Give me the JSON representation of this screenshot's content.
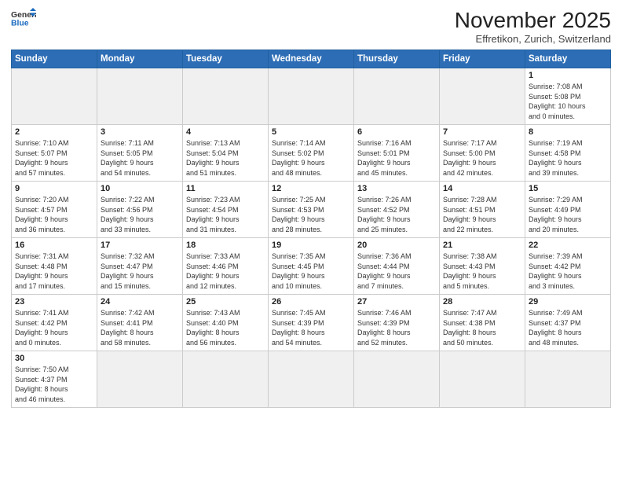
{
  "logo": {
    "line1": "General",
    "line2": "Blue"
  },
  "title": "November 2025",
  "location": "Effretikon, Zurich, Switzerland",
  "weekdays": [
    "Sunday",
    "Monday",
    "Tuesday",
    "Wednesday",
    "Thursday",
    "Friday",
    "Saturday"
  ],
  "weeks": [
    [
      {
        "day": "",
        "info": ""
      },
      {
        "day": "",
        "info": ""
      },
      {
        "day": "",
        "info": ""
      },
      {
        "day": "",
        "info": ""
      },
      {
        "day": "",
        "info": ""
      },
      {
        "day": "",
        "info": ""
      },
      {
        "day": "1",
        "info": "Sunrise: 7:08 AM\nSunset: 5:08 PM\nDaylight: 10 hours\nand 0 minutes."
      }
    ],
    [
      {
        "day": "2",
        "info": "Sunrise: 7:10 AM\nSunset: 5:07 PM\nDaylight: 9 hours\nand 57 minutes."
      },
      {
        "day": "3",
        "info": "Sunrise: 7:11 AM\nSunset: 5:05 PM\nDaylight: 9 hours\nand 54 minutes."
      },
      {
        "day": "4",
        "info": "Sunrise: 7:13 AM\nSunset: 5:04 PM\nDaylight: 9 hours\nand 51 minutes."
      },
      {
        "day": "5",
        "info": "Sunrise: 7:14 AM\nSunset: 5:02 PM\nDaylight: 9 hours\nand 48 minutes."
      },
      {
        "day": "6",
        "info": "Sunrise: 7:16 AM\nSunset: 5:01 PM\nDaylight: 9 hours\nand 45 minutes."
      },
      {
        "day": "7",
        "info": "Sunrise: 7:17 AM\nSunset: 5:00 PM\nDaylight: 9 hours\nand 42 minutes."
      },
      {
        "day": "8",
        "info": "Sunrise: 7:19 AM\nSunset: 4:58 PM\nDaylight: 9 hours\nand 39 minutes."
      }
    ],
    [
      {
        "day": "9",
        "info": "Sunrise: 7:20 AM\nSunset: 4:57 PM\nDaylight: 9 hours\nand 36 minutes."
      },
      {
        "day": "10",
        "info": "Sunrise: 7:22 AM\nSunset: 4:56 PM\nDaylight: 9 hours\nand 33 minutes."
      },
      {
        "day": "11",
        "info": "Sunrise: 7:23 AM\nSunset: 4:54 PM\nDaylight: 9 hours\nand 31 minutes."
      },
      {
        "day": "12",
        "info": "Sunrise: 7:25 AM\nSunset: 4:53 PM\nDaylight: 9 hours\nand 28 minutes."
      },
      {
        "day": "13",
        "info": "Sunrise: 7:26 AM\nSunset: 4:52 PM\nDaylight: 9 hours\nand 25 minutes."
      },
      {
        "day": "14",
        "info": "Sunrise: 7:28 AM\nSunset: 4:51 PM\nDaylight: 9 hours\nand 22 minutes."
      },
      {
        "day": "15",
        "info": "Sunrise: 7:29 AM\nSunset: 4:49 PM\nDaylight: 9 hours\nand 20 minutes."
      }
    ],
    [
      {
        "day": "16",
        "info": "Sunrise: 7:31 AM\nSunset: 4:48 PM\nDaylight: 9 hours\nand 17 minutes."
      },
      {
        "day": "17",
        "info": "Sunrise: 7:32 AM\nSunset: 4:47 PM\nDaylight: 9 hours\nand 15 minutes."
      },
      {
        "day": "18",
        "info": "Sunrise: 7:33 AM\nSunset: 4:46 PM\nDaylight: 9 hours\nand 12 minutes."
      },
      {
        "day": "19",
        "info": "Sunrise: 7:35 AM\nSunset: 4:45 PM\nDaylight: 9 hours\nand 10 minutes."
      },
      {
        "day": "20",
        "info": "Sunrise: 7:36 AM\nSunset: 4:44 PM\nDaylight: 9 hours\nand 7 minutes."
      },
      {
        "day": "21",
        "info": "Sunrise: 7:38 AM\nSunset: 4:43 PM\nDaylight: 9 hours\nand 5 minutes."
      },
      {
        "day": "22",
        "info": "Sunrise: 7:39 AM\nSunset: 4:42 PM\nDaylight: 9 hours\nand 3 minutes."
      }
    ],
    [
      {
        "day": "23",
        "info": "Sunrise: 7:41 AM\nSunset: 4:42 PM\nDaylight: 9 hours\nand 0 minutes."
      },
      {
        "day": "24",
        "info": "Sunrise: 7:42 AM\nSunset: 4:41 PM\nDaylight: 8 hours\nand 58 minutes."
      },
      {
        "day": "25",
        "info": "Sunrise: 7:43 AM\nSunset: 4:40 PM\nDaylight: 8 hours\nand 56 minutes."
      },
      {
        "day": "26",
        "info": "Sunrise: 7:45 AM\nSunset: 4:39 PM\nDaylight: 8 hours\nand 54 minutes."
      },
      {
        "day": "27",
        "info": "Sunrise: 7:46 AM\nSunset: 4:39 PM\nDaylight: 8 hours\nand 52 minutes."
      },
      {
        "day": "28",
        "info": "Sunrise: 7:47 AM\nSunset: 4:38 PM\nDaylight: 8 hours\nand 50 minutes."
      },
      {
        "day": "29",
        "info": "Sunrise: 7:49 AM\nSunset: 4:37 PM\nDaylight: 8 hours\nand 48 minutes."
      }
    ],
    [
      {
        "day": "30",
        "info": "Sunrise: 7:50 AM\nSunset: 4:37 PM\nDaylight: 8 hours\nand 46 minutes."
      },
      {
        "day": "",
        "info": ""
      },
      {
        "day": "",
        "info": ""
      },
      {
        "day": "",
        "info": ""
      },
      {
        "day": "",
        "info": ""
      },
      {
        "day": "",
        "info": ""
      },
      {
        "day": "",
        "info": ""
      }
    ]
  ]
}
